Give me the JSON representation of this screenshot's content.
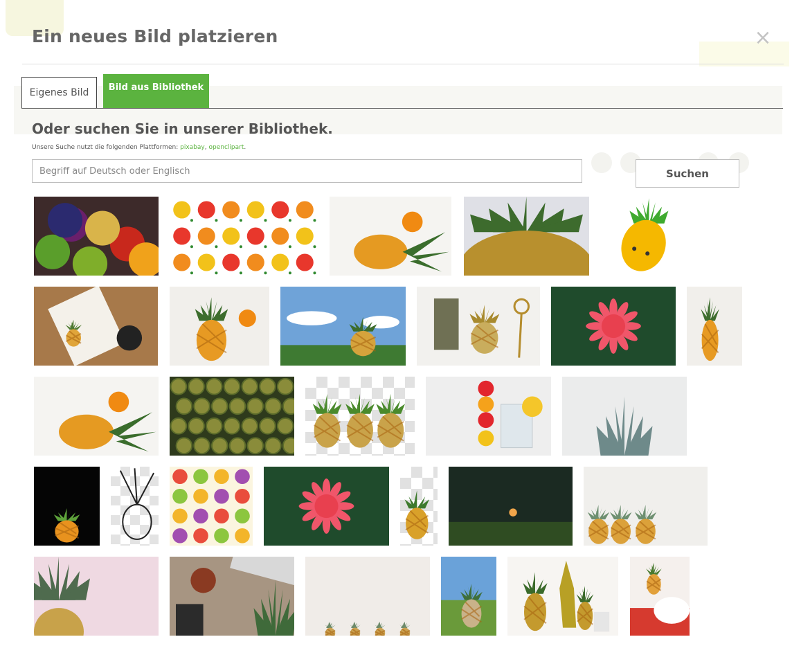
{
  "modal": {
    "title": "Ein neues Bild platzieren",
    "close_glyph": "×"
  },
  "tabs": [
    {
      "label": "Eigenes Bild",
      "active": false
    },
    {
      "label": "Bild aus Bibliothek",
      "active": true
    }
  ],
  "library": {
    "heading": "Oder suchen Sie in unserer Bibliothek.",
    "platforms_prefix": "Unsere Suche nutzt die folgenden Plattformen:",
    "platforms": [
      "pixabay",
      "openclipart"
    ],
    "separator": ",",
    "trailing": "."
  },
  "search": {
    "placeholder": "Begriff auf Deutsch oder Englisch",
    "value": "",
    "button_label": "Suchen"
  },
  "colors": {
    "accent": "#5bb33f"
  },
  "results": [
    {
      "subject": "assorted fruits"
    },
    {
      "subject": "fruit faces pattern"
    },
    {
      "subject": "pineapple and orange"
    },
    {
      "subject": "pineapple close-up"
    },
    {
      "subject": "kawaii pineapple clipart"
    },
    {
      "subject": "notebook with pineapple sketch and coffee"
    },
    {
      "subject": "pineapple with orange"
    },
    {
      "subject": "pineapple in field under sky"
    },
    {
      "subject": "notebook gold pineapple scissors"
    },
    {
      "subject": "pink bromeliad flower"
    },
    {
      "subject": "pineapple on grey"
    },
    {
      "subject": "lying pineapple"
    },
    {
      "subject": "pineapple skin texture"
    },
    {
      "subject": "three pineapples transparent"
    },
    {
      "subject": "fruit skewers with drinks"
    },
    {
      "subject": "pineapple crown on grey"
    },
    {
      "subject": "pineapple on black"
    },
    {
      "subject": "pineapple line drawing"
    },
    {
      "subject": "watercolor fruit pattern"
    },
    {
      "subject": "pink pineapple flower"
    },
    {
      "subject": "pineapple transparent"
    },
    {
      "subject": "dark forest scene"
    },
    {
      "subject": "three pineapples on white"
    },
    {
      "subject": "pineapple on pink"
    },
    {
      "subject": "desk with laptop and pineapple"
    },
    {
      "subject": "small pineapples row"
    },
    {
      "subject": "pineapple landscape"
    },
    {
      "subject": "pineapples with glass vases"
    },
    {
      "subject": "pineapple and fruit bowl"
    }
  ]
}
